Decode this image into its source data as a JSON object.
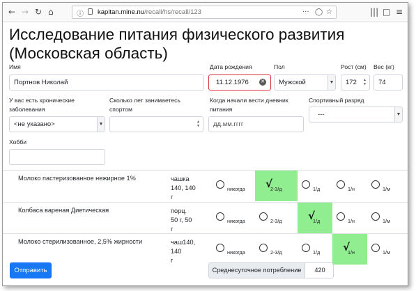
{
  "browser": {
    "url_host": "kapitan.mine.nu",
    "url_path": "/recall/hs/recall/123",
    "url_more": "···"
  },
  "form": {
    "title": "Исследование питания физического развития (Московская область)",
    "name": {
      "label": "Имя",
      "value": "Портнов Николай"
    },
    "birth_date": {
      "label": "Дата рождения",
      "value": "11.12.1976"
    },
    "sex": {
      "label": "Пол",
      "value": "Мужской"
    },
    "height": {
      "label": "Рост (см)",
      "value": "172"
    },
    "weight": {
      "label": "Вес (кг)",
      "value": "74"
    },
    "chronic": {
      "label": "У вас есть хронические заболевания",
      "value": "<не указано>"
    },
    "sport_years": {
      "label": "Сколько лет занимаетесь спортом",
      "value": ""
    },
    "diary_start": {
      "label": "Когда начали вести дневник питания",
      "placeholder": "дд.мм.гггг"
    },
    "sport_rank": {
      "label": "Спортивный разряд",
      "value": "---"
    },
    "hobby": {
      "label": "Хобби",
      "value": ""
    }
  },
  "frequency_options": [
    "никогда",
    "2-3/д",
    "1/д",
    "1/н",
    "1/м"
  ],
  "foods": [
    {
      "name": "Молоко пастеризованное нежирное 1%",
      "portion_line1": "чашка",
      "portion_line2": "140, 140",
      "portion_line3": "г",
      "selected": "2-3/д"
    },
    {
      "name": "Колбаса вареная Диетическая",
      "portion_line1": "порц.",
      "portion_line2": "50 г, 50",
      "portion_line3": "г",
      "selected": "1/д"
    },
    {
      "name": "Молоко стерилизованное, 2,5% жирности",
      "portion_line1": "чаш140,",
      "portion_line2": "140",
      "portion_line3": "г",
      "selected": "1/н"
    }
  ],
  "submit_label": "Отправить",
  "average": {
    "label": "Среднесуточное потребление",
    "value": "420"
  },
  "colors": {
    "selected_bg": "#90ee90",
    "primary": "#1877f2",
    "invalid": "#dc3545"
  }
}
